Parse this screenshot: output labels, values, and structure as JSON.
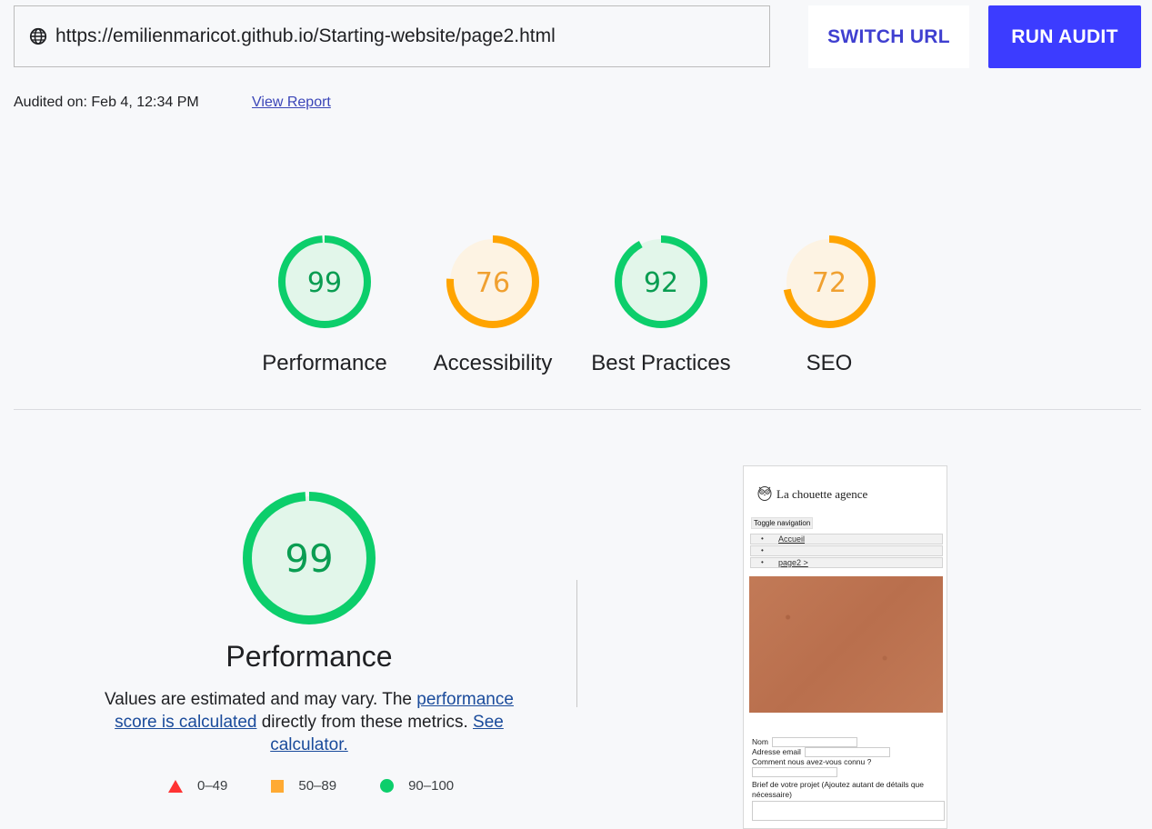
{
  "toolbar": {
    "url": "https://emilienmaricot.github.io/Starting-website/page2.html",
    "switch_label": "SWITCH URL",
    "run_label": "RUN AUDIT",
    "globe_icon": "globe-icon"
  },
  "meta": {
    "audited_on": "Audited on: Feb 4, 12:34 PM",
    "view_report": "View Report"
  },
  "colors": {
    "pass": "#0cce6b",
    "average": "#ffa400",
    "fail": "#ff3333",
    "accent": "#3c3cff"
  },
  "scores": [
    {
      "label": "Performance",
      "value": 99,
      "rating": "pass"
    },
    {
      "label": "Accessibility",
      "value": 76,
      "rating": "average"
    },
    {
      "label": "Best Practices",
      "value": 92,
      "rating": "pass"
    },
    {
      "label": "SEO",
      "value": 72,
      "rating": "average"
    }
  ],
  "detail": {
    "score": 99,
    "title": "Performance",
    "desc_1": "Values are estimated and may vary. The ",
    "link_1": "performance score is calculated",
    "desc_2": " directly from these metrics. ",
    "link_2": "See calculator."
  },
  "legend": [
    {
      "range": "0–49",
      "shape": "triangle"
    },
    {
      "range": "50–89",
      "shape": "square"
    },
    {
      "range": "90–100",
      "shape": "circle"
    }
  ],
  "thumbnail": {
    "brand": "La chouette agence",
    "toggle": "Toggle navigation",
    "nav": [
      "Accueil",
      "",
      "page2 >"
    ],
    "form_nom": "Nom",
    "form_email": "Adresse email",
    "form_how": "Comment nous avez-vous connu ?",
    "form_brief": "Brief de votre projet (Ajoutez autant de détails que nécessaire)"
  }
}
